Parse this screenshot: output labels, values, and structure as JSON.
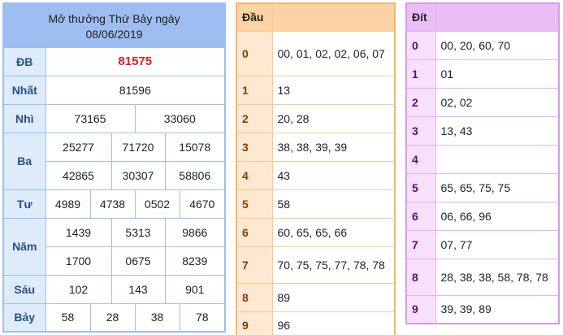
{
  "results": {
    "title_line1": "Mở thưởng Thứ Bảy ngày",
    "title_line2": "08/06/2019",
    "rows": {
      "db": {
        "label": "ĐB",
        "values": [
          "81575"
        ]
      },
      "nhat": {
        "label": "Nhất",
        "values": [
          "81596"
        ]
      },
      "nhi": {
        "label": "Nhì",
        "values": [
          "73165",
          "33060"
        ]
      },
      "ba": {
        "label": "Ba",
        "values": [
          "25277",
          "71720",
          "15078",
          "42865",
          "30307",
          "58806"
        ]
      },
      "tu": {
        "label": "Tư",
        "values": [
          "4989",
          "4738",
          "0502",
          "4670"
        ]
      },
      "nam": {
        "label": "Năm",
        "values": [
          "1439",
          "5313",
          "9866",
          "1700",
          "0675",
          "8239"
        ]
      },
      "sau": {
        "label": "Sáu",
        "values": [
          "102",
          "143",
          "901"
        ]
      },
      "bay": {
        "label": "Bảy",
        "values": [
          "58",
          "28",
          "38",
          "78"
        ]
      }
    }
  },
  "dau": {
    "header": "Đầu",
    "rows": [
      {
        "key": "0",
        "value": "00, 01, 02, 02, 06, 07"
      },
      {
        "key": "1",
        "value": "13"
      },
      {
        "key": "2",
        "value": "20, 28"
      },
      {
        "key": "3",
        "value": "38, 38, 39, 39"
      },
      {
        "key": "4",
        "value": "43"
      },
      {
        "key": "5",
        "value": "58"
      },
      {
        "key": "6",
        "value": "60, 65, 65, 66"
      },
      {
        "key": "7",
        "value": "70, 75, 75, 77, 78, 78"
      },
      {
        "key": "8",
        "value": "89"
      },
      {
        "key": "9",
        "value": "96"
      }
    ]
  },
  "dit": {
    "header": "Đít",
    "rows": [
      {
        "key": "0",
        "value": "00, 20, 60, 70"
      },
      {
        "key": "1",
        "value": "01"
      },
      {
        "key": "2",
        "value": "02, 02"
      },
      {
        "key": "3",
        "value": "13, 43"
      },
      {
        "key": "4",
        "value": ""
      },
      {
        "key": "5",
        "value": "65, 65, 75, 75"
      },
      {
        "key": "6",
        "value": "06, 66, 96"
      },
      {
        "key": "7",
        "value": "07, 77"
      },
      {
        "key": "8",
        "value": "28, 38, 38, 58, 78, 78"
      },
      {
        "key": "9",
        "value": "39, 39, 89"
      }
    ]
  },
  "colors": {
    "results_border": "#9ebdf0",
    "results_label_bg": "#ddebfb",
    "special_prize": "#e8171f",
    "dau_border": "#f6b66e",
    "dau_header_bg": "#fbd2a3",
    "dit_border": "#d49be8",
    "dit_header_bg": "#ebbdf6"
  }
}
